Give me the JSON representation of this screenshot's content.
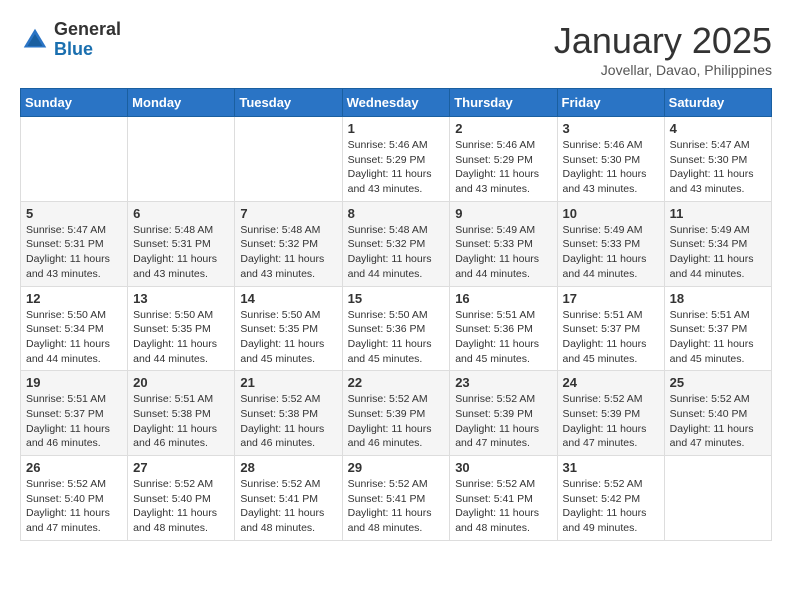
{
  "header": {
    "logo_general": "General",
    "logo_blue": "Blue",
    "month_title": "January 2025",
    "location": "Jovellar, Davao, Philippines"
  },
  "weekdays": [
    "Sunday",
    "Monday",
    "Tuesday",
    "Wednesday",
    "Thursday",
    "Friday",
    "Saturday"
  ],
  "weeks": [
    [
      {
        "day": "",
        "info": ""
      },
      {
        "day": "",
        "info": ""
      },
      {
        "day": "",
        "info": ""
      },
      {
        "day": "1",
        "info": "Sunrise: 5:46 AM\nSunset: 5:29 PM\nDaylight: 11 hours\nand 43 minutes."
      },
      {
        "day": "2",
        "info": "Sunrise: 5:46 AM\nSunset: 5:29 PM\nDaylight: 11 hours\nand 43 minutes."
      },
      {
        "day": "3",
        "info": "Sunrise: 5:46 AM\nSunset: 5:30 PM\nDaylight: 11 hours\nand 43 minutes."
      },
      {
        "day": "4",
        "info": "Sunrise: 5:47 AM\nSunset: 5:30 PM\nDaylight: 11 hours\nand 43 minutes."
      }
    ],
    [
      {
        "day": "5",
        "info": "Sunrise: 5:47 AM\nSunset: 5:31 PM\nDaylight: 11 hours\nand 43 minutes."
      },
      {
        "day": "6",
        "info": "Sunrise: 5:48 AM\nSunset: 5:31 PM\nDaylight: 11 hours\nand 43 minutes."
      },
      {
        "day": "7",
        "info": "Sunrise: 5:48 AM\nSunset: 5:32 PM\nDaylight: 11 hours\nand 43 minutes."
      },
      {
        "day": "8",
        "info": "Sunrise: 5:48 AM\nSunset: 5:32 PM\nDaylight: 11 hours\nand 44 minutes."
      },
      {
        "day": "9",
        "info": "Sunrise: 5:49 AM\nSunset: 5:33 PM\nDaylight: 11 hours\nand 44 minutes."
      },
      {
        "day": "10",
        "info": "Sunrise: 5:49 AM\nSunset: 5:33 PM\nDaylight: 11 hours\nand 44 minutes."
      },
      {
        "day": "11",
        "info": "Sunrise: 5:49 AM\nSunset: 5:34 PM\nDaylight: 11 hours\nand 44 minutes."
      }
    ],
    [
      {
        "day": "12",
        "info": "Sunrise: 5:50 AM\nSunset: 5:34 PM\nDaylight: 11 hours\nand 44 minutes."
      },
      {
        "day": "13",
        "info": "Sunrise: 5:50 AM\nSunset: 5:35 PM\nDaylight: 11 hours\nand 44 minutes."
      },
      {
        "day": "14",
        "info": "Sunrise: 5:50 AM\nSunset: 5:35 PM\nDaylight: 11 hours\nand 45 minutes."
      },
      {
        "day": "15",
        "info": "Sunrise: 5:50 AM\nSunset: 5:36 PM\nDaylight: 11 hours\nand 45 minutes."
      },
      {
        "day": "16",
        "info": "Sunrise: 5:51 AM\nSunset: 5:36 PM\nDaylight: 11 hours\nand 45 minutes."
      },
      {
        "day": "17",
        "info": "Sunrise: 5:51 AM\nSunset: 5:37 PM\nDaylight: 11 hours\nand 45 minutes."
      },
      {
        "day": "18",
        "info": "Sunrise: 5:51 AM\nSunset: 5:37 PM\nDaylight: 11 hours\nand 45 minutes."
      }
    ],
    [
      {
        "day": "19",
        "info": "Sunrise: 5:51 AM\nSunset: 5:37 PM\nDaylight: 11 hours\nand 46 minutes."
      },
      {
        "day": "20",
        "info": "Sunrise: 5:51 AM\nSunset: 5:38 PM\nDaylight: 11 hours\nand 46 minutes."
      },
      {
        "day": "21",
        "info": "Sunrise: 5:52 AM\nSunset: 5:38 PM\nDaylight: 11 hours\nand 46 minutes."
      },
      {
        "day": "22",
        "info": "Sunrise: 5:52 AM\nSunset: 5:39 PM\nDaylight: 11 hours\nand 46 minutes."
      },
      {
        "day": "23",
        "info": "Sunrise: 5:52 AM\nSunset: 5:39 PM\nDaylight: 11 hours\nand 47 minutes."
      },
      {
        "day": "24",
        "info": "Sunrise: 5:52 AM\nSunset: 5:39 PM\nDaylight: 11 hours\nand 47 minutes."
      },
      {
        "day": "25",
        "info": "Sunrise: 5:52 AM\nSunset: 5:40 PM\nDaylight: 11 hours\nand 47 minutes."
      }
    ],
    [
      {
        "day": "26",
        "info": "Sunrise: 5:52 AM\nSunset: 5:40 PM\nDaylight: 11 hours\nand 47 minutes."
      },
      {
        "day": "27",
        "info": "Sunrise: 5:52 AM\nSunset: 5:40 PM\nDaylight: 11 hours\nand 48 minutes."
      },
      {
        "day": "28",
        "info": "Sunrise: 5:52 AM\nSunset: 5:41 PM\nDaylight: 11 hours\nand 48 minutes."
      },
      {
        "day": "29",
        "info": "Sunrise: 5:52 AM\nSunset: 5:41 PM\nDaylight: 11 hours\nand 48 minutes."
      },
      {
        "day": "30",
        "info": "Sunrise: 5:52 AM\nSunset: 5:41 PM\nDaylight: 11 hours\nand 48 minutes."
      },
      {
        "day": "31",
        "info": "Sunrise: 5:52 AM\nSunset: 5:42 PM\nDaylight: 11 hours\nand 49 minutes."
      },
      {
        "day": "",
        "info": ""
      }
    ]
  ]
}
